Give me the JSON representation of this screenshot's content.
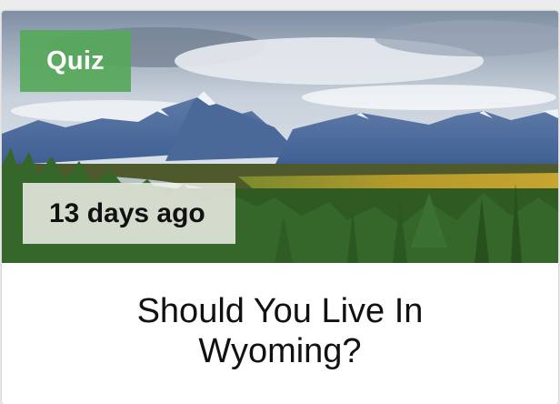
{
  "card": {
    "badge_label": "Quiz",
    "posted_ago": "13 days ago",
    "title": "Should You Live In Wyoming?",
    "image_subject": "mountain-landscape",
    "colors": {
      "badge_green": "#56a85a",
      "title_text": "#111111",
      "card_background": "#ffffff"
    }
  }
}
